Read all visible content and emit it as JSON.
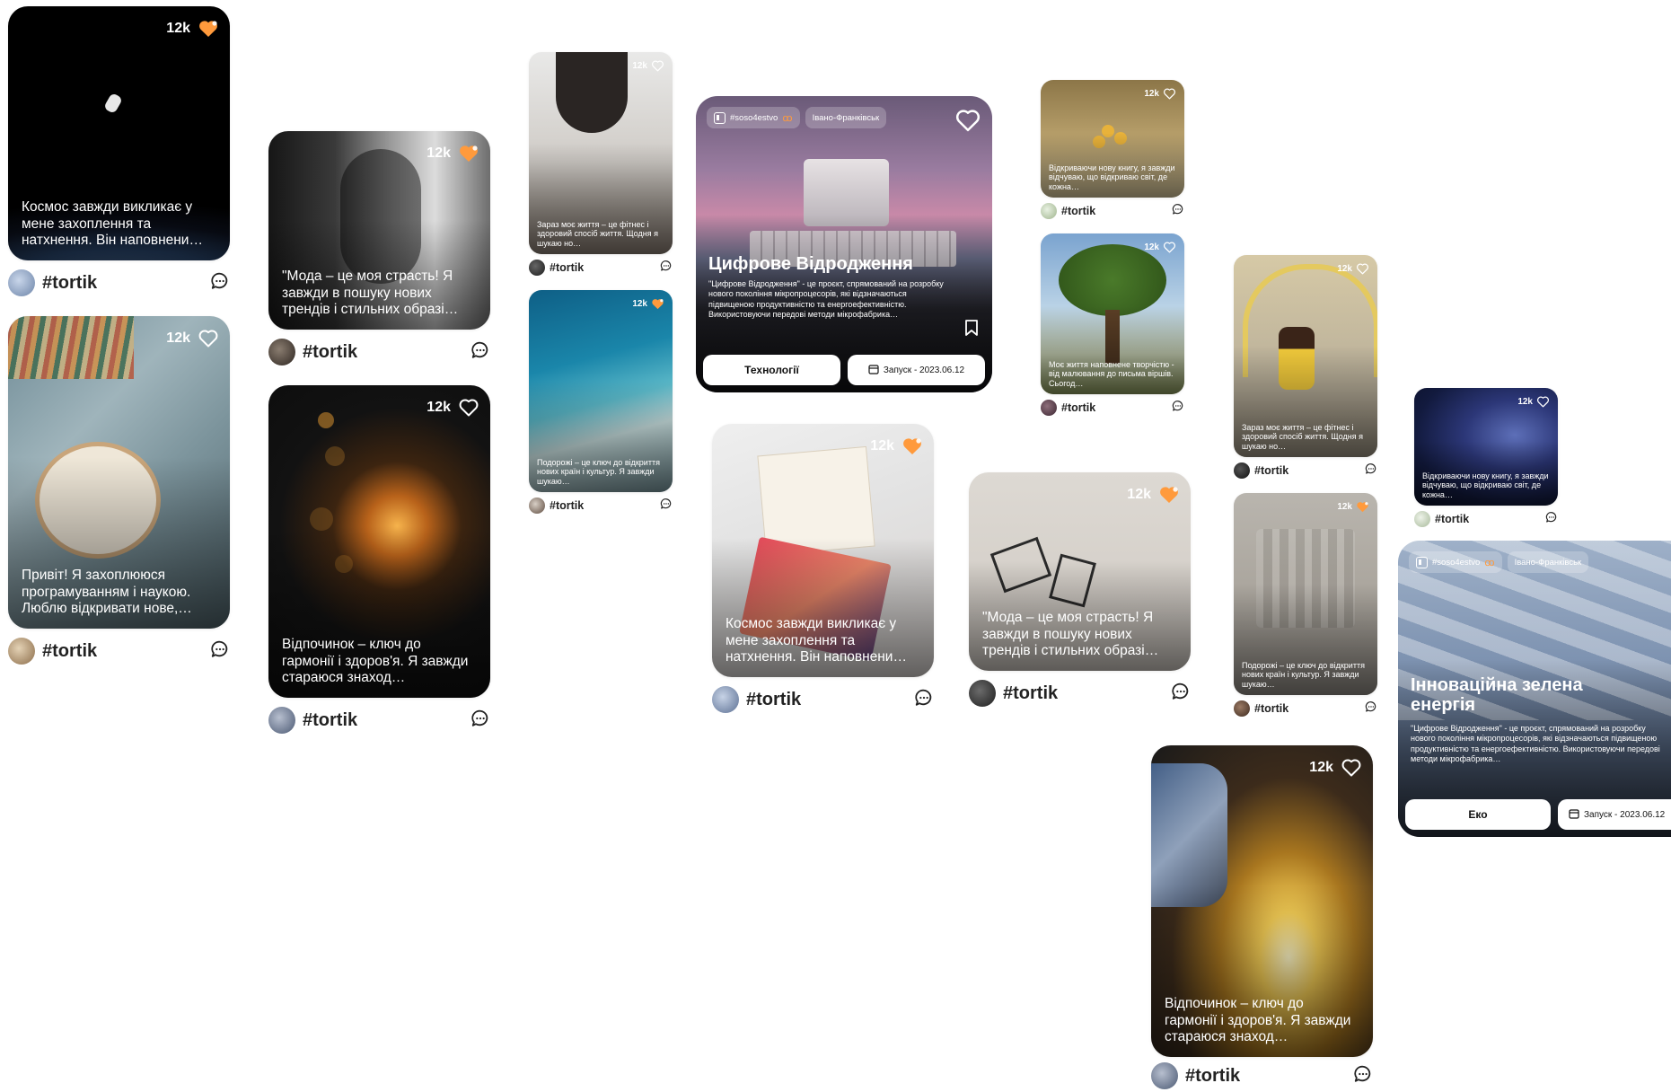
{
  "colors": {
    "accent": "#ff9a3c",
    "text": "#222222",
    "white": "#ffffff"
  },
  "icons": {
    "like_outline": "heart-outline-icon",
    "like_filled": "heart-filled-icon",
    "comment": "comment-icon",
    "bookmark": "bookmark-icon",
    "calendar": "calendar-icon",
    "logo": "project-logo-icon",
    "coop": "handshake-icon"
  },
  "posts": [
    {
      "id": "p1",
      "likes": "12k",
      "liked": true,
      "caption": "Космос завжди викликає у мене захоплення та натхнення. Він наповнени…",
      "tag": "#tortik"
    },
    {
      "id": "p2",
      "likes": "12k",
      "liked": false,
      "caption": "Привіт! Я захоплююся програмуванням і наукою. Люблю відкривати нове,…",
      "tag": "#tortik"
    },
    {
      "id": "p3",
      "likes": "12k",
      "liked": true,
      "caption": "\"Мода – це моя страсть! Я завжди в пошуку нових трендів і стильних образі…",
      "tag": "#tortik"
    },
    {
      "id": "p4",
      "likes": "12k",
      "liked": false,
      "caption": "Відпочинок – ключ до гармонії і здоров'я. Я завжди стараюся знаход…",
      "tag": "#tortik"
    },
    {
      "id": "p5",
      "likes": "12k",
      "liked": false,
      "caption": "Зараз моє життя – це фітнес і здоровий спосіб життя. Щодня я шукаю но…",
      "tag": "#tortik"
    },
    {
      "id": "p6",
      "likes": "12k",
      "liked": true,
      "caption": "Подорожі – це ключ до відкриття нових країн і культур. Я завжди шукаю…",
      "tag": "#tortik"
    },
    {
      "id": "p7",
      "likes": "12k",
      "liked": true,
      "caption": "Космос завжди викликає у мене захоплення та натхнення. Він наповнени…",
      "tag": "#tortik"
    },
    {
      "id": "p8",
      "likes": "12k",
      "liked": false,
      "caption": "Відкриваючи нову книгу, я завжди відчуваю, що відкриваю світ, де кожна…",
      "tag": "#tortik"
    },
    {
      "id": "p9",
      "likes": "12k",
      "liked": false,
      "caption": "Моє життя наповнене творчістю - від малювання до письма віршів. Сьогод…",
      "tag": "#tortik"
    },
    {
      "id": "p10",
      "likes": "12k",
      "liked": true,
      "caption": "\"Мода – це моя страсть! Я завжди в пошуку нових трендів і стильних образі…",
      "tag": "#tortik"
    },
    {
      "id": "p11",
      "likes": "12k",
      "liked": false,
      "caption": "Зараз моє життя – це фітнес і здоровий спосіб життя. Щодня я шукаю но…",
      "tag": "#tortik"
    },
    {
      "id": "p12",
      "likes": "12k",
      "liked": true,
      "caption": "Подорожі – це ключ до відкриття нових країн і культур. Я завжди шукаю…",
      "tag": "#tortik"
    },
    {
      "id": "p13",
      "likes": "12k",
      "liked": false,
      "caption": "Відкриваючи нову книгу, я завжди відчуваю, що відкриваю світ, де кожна…",
      "tag": "#tortik"
    },
    {
      "id": "p14",
      "likes": "12k",
      "liked": false,
      "caption": "Відпочинок – ключ до гармонії і здоров'я. Я завжди стараюся знаход…",
      "tag": "#tortik"
    }
  ],
  "projects": [
    {
      "id": "pr1",
      "account": "#soso4estvo",
      "city": "Івано-Франківськ",
      "title": "Цифрове Відродження",
      "description": "\"Цифрове Відродження\" - це проєкт, спрямований на розробку нового покоління мікропроцесорів, які відзначаються підвищеною продуктивністю та енергоефективністю. Використовуючи передові методи мікрофабрика…",
      "category": "Технології",
      "launch": "Запуск - 2023.06.12"
    },
    {
      "id": "pr2",
      "account": "#soso4estvo",
      "city": "Івано-Франківськ",
      "title": "Інноваційна зелена енергія",
      "description": "\"Цифрове Відродження\" - це проєкт, спрямований на розробку нового покоління мікропроцесорів, які відзначаються підвищеною продуктивністю та енергоефективністю. Використовуючи передові методи мікрофабрика…",
      "category": "Еко",
      "launch": "Запуск - 2023.06.12"
    }
  ]
}
